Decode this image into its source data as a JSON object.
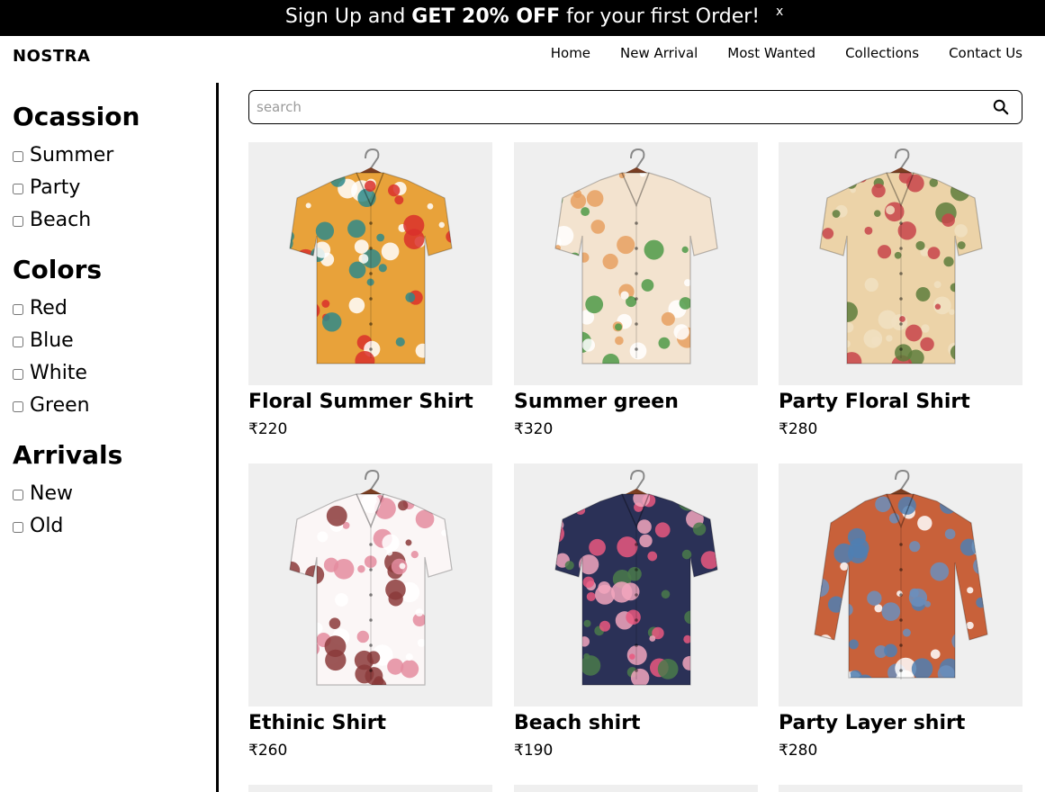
{
  "promo": {
    "text_before": "Sign Up and ",
    "text_bold": "GET 20% OFF",
    "text_after": " for your first Order!",
    "close_label": "x"
  },
  "brand": "NOSTRA",
  "nav": [
    "Home",
    "New Arrival",
    "Most Wanted",
    "Collections",
    "Contact Us"
  ],
  "filters": [
    {
      "title": "Ocassion",
      "options": [
        "Summer",
        "Party",
        "Beach"
      ]
    },
    {
      "title": "Colors",
      "options": [
        "Red",
        "Blue",
        "White",
        "Green"
      ]
    },
    {
      "title": "Arrivals",
      "options": [
        "New",
        "Old"
      ]
    }
  ],
  "search": {
    "placeholder": "search",
    "icon": "search-icon"
  },
  "products": [
    {
      "name": "Floral Summer Shirt",
      "price": "₹220",
      "colors": [
        "#e8a23a",
        "#2f8a8a",
        "#ffffff",
        "#d9302c"
      ]
    },
    {
      "name": "Summer green",
      "price": "₹320",
      "colors": [
        "#f3e3cf",
        "#4e9a48",
        "#ffffff",
        "#e6a060"
      ]
    },
    {
      "name": "Party Floral Shirt",
      "price": "₹280",
      "colors": [
        "#ecd3a8",
        "#c8434a",
        "#5e7d3c",
        "#f1e1c2"
      ]
    },
    {
      "name": "Ethinic Shirt",
      "price": "₹260",
      "colors": [
        "#fbf6f6",
        "#e48c9f",
        "#8b3a3a",
        "#ffffff"
      ]
    },
    {
      "name": "Beach shirt",
      "price": "₹190",
      "colors": [
        "#2b3157",
        "#e9587f",
        "#f2a6bd",
        "#4a7a4a"
      ]
    },
    {
      "name": "Party Layer shirt",
      "price": "₹280",
      "colors": [
        "#c8613a",
        "#4f7fb3",
        "#ffffff",
        "#6b8fbd"
      ]
    }
  ]
}
